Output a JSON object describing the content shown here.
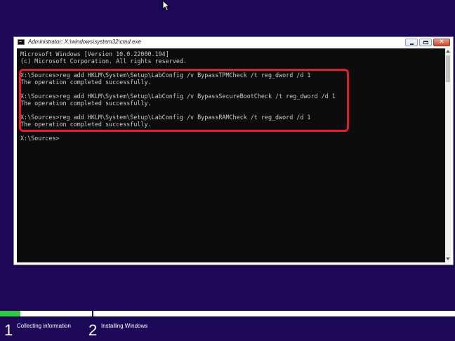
{
  "window": {
    "title": "Administrator: X:\\windows\\system32\\cmd.exe",
    "close_glyph": "✕"
  },
  "console": {
    "lines": [
      "Microsoft Windows [Version 10.0.22000.194]",
      "(c) Microsoft Corporation. All rights reserved.",
      "",
      "X:\\Sources>reg add HKLM\\System\\Setup\\LabConfig /v BypassTPMCheck /t reg_dword /d 1",
      "The operation completed successfully.",
      "",
      "X:\\Sources>reg add HKLM\\System\\Setup\\LabConfig /v BypassSecureBootCheck /t reg_dword /d 1",
      "The operation completed successfully.",
      "",
      "X:\\Sources>reg add HKLM\\System\\Setup\\LabConfig /v BypassRAMCheck /t reg_dword /d 1",
      "The operation completed successfully.",
      "",
      "X:\\Sources>"
    ]
  },
  "setup": {
    "progress_fraction": 0.045,
    "steps": [
      {
        "number": "1",
        "label": "Collecting information"
      },
      {
        "number": "2",
        "label": "Installing Windows"
      }
    ]
  },
  "colors": {
    "background": "#1d0757",
    "console_bg": "#0c0c0c",
    "console_text": "#cccccc",
    "highlight": "#e31b2d",
    "progress": "#2ecc40"
  }
}
